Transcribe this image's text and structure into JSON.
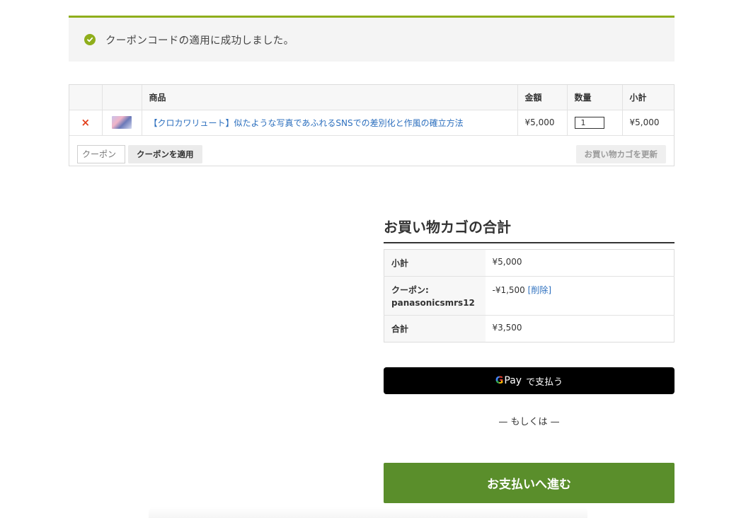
{
  "notice": {
    "message": "クーポンコードの適用に成功しました。",
    "icon": "check-circle-icon",
    "accent_color": "#8fae1b"
  },
  "cart": {
    "headers": {
      "product": "商品",
      "price": "金額",
      "quantity": "数量",
      "subtotal": "小計"
    },
    "item": {
      "remove": "×",
      "name": "【クロカワリュート】似たような写真であふれるSNSでの差別化と作風の確立方法",
      "price": "¥5,000",
      "quantity": "1",
      "subtotal": "¥5,000"
    },
    "coupon_placeholder": "クーポン",
    "apply_coupon_label": "クーポンを適用",
    "update_cart_label": "お買い物カゴを更新"
  },
  "totals": {
    "title": "お買い物カゴの合計",
    "subtotal_label": "小計",
    "subtotal_value": "¥5,000",
    "coupon_label": "クーポン:",
    "coupon_code": "panasonicsmrs12",
    "coupon_value": "-¥1,500",
    "coupon_remove": "[削除]",
    "total_label": "合計",
    "total_value": "¥3,500"
  },
  "payment": {
    "gpay_g": "G",
    "gpay_pay": "Pay",
    "gpay_text": "で支払う",
    "or_text": "— もしくは —",
    "checkout_label": "お支払いへ進む",
    "checkout_color": "#5a8e2b"
  }
}
